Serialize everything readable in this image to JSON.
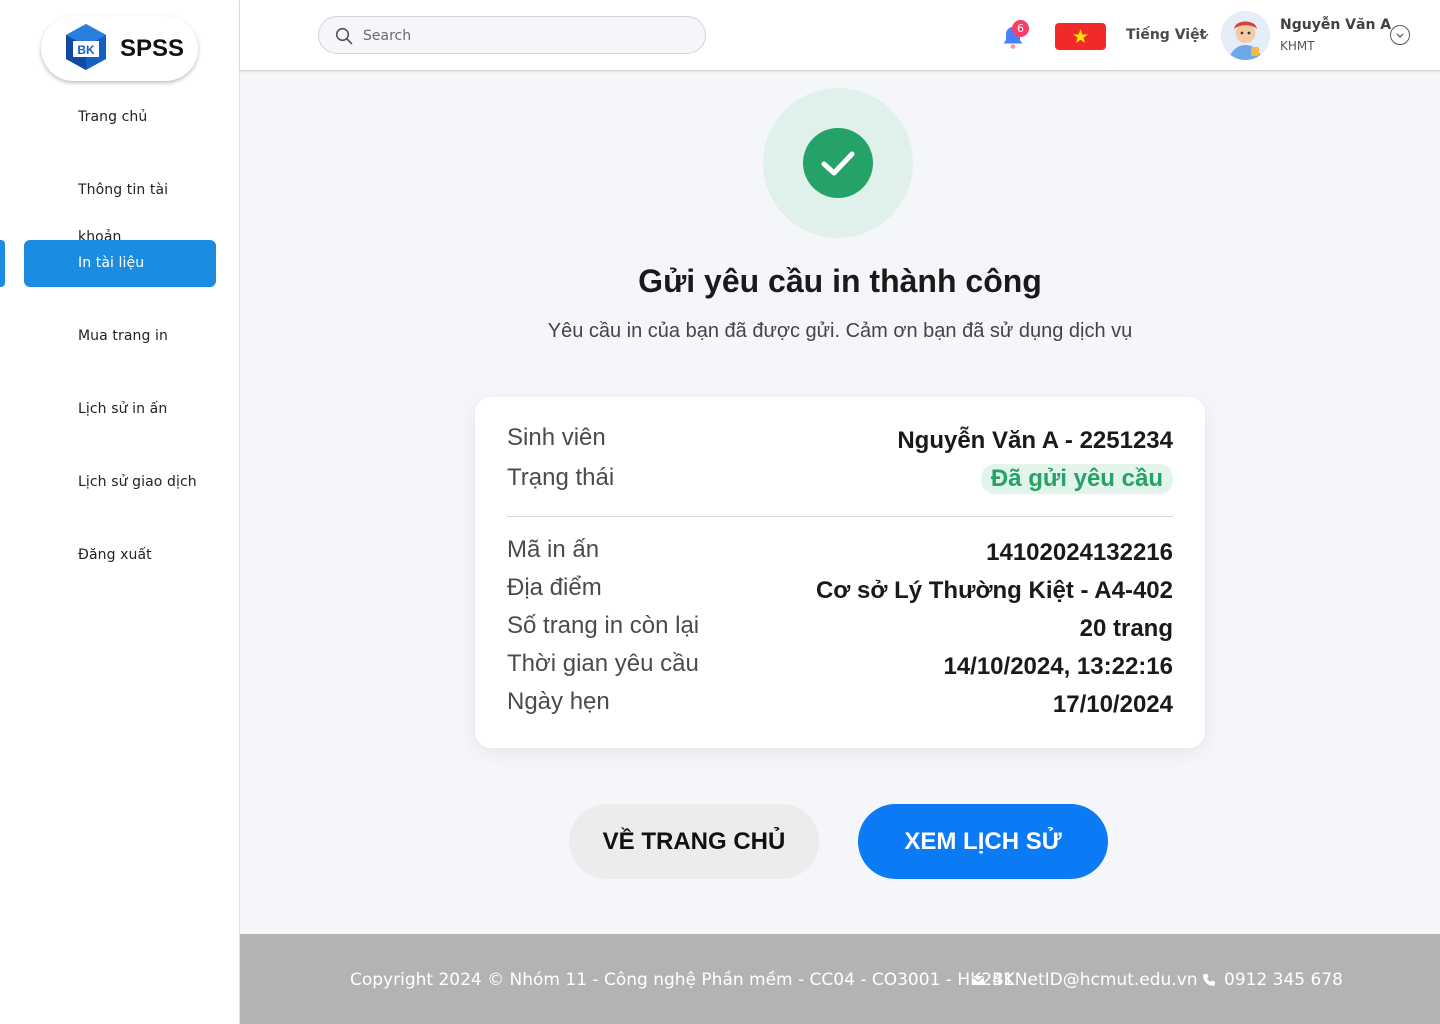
{
  "app": {
    "name": "SPSS",
    "logo_text": "BK"
  },
  "sidebar": {
    "items": [
      {
        "label": "Trang chủ",
        "active": false
      },
      {
        "label": "Thông tin tài khoản",
        "active": false
      },
      {
        "label": "In tài liệu",
        "active": true
      },
      {
        "label": "Mua trang in",
        "active": false
      },
      {
        "label": "Lịch sử in ấn",
        "active": false
      },
      {
        "label": "Lịch sử giao dịch",
        "active": false
      },
      {
        "label": "Đăng xuất",
        "active": false
      }
    ]
  },
  "header": {
    "search_placeholder": "Search",
    "notification_count": "6",
    "language": "Tiếng Việt",
    "user_name": "Nguyễn Văn A",
    "user_role": "KHMT"
  },
  "main": {
    "title": "Gửi yêu cầu in thành công",
    "subtitle": "Yêu cầu in của bạn đã được gửi. Cảm ơn bạn đã sử dụng dịch vụ",
    "card": {
      "student_label": "Sinh viên",
      "student_value": "Nguyễn Văn A - 2251234",
      "status_label": "Trạng thái",
      "status_value": "Đã gửi yêu cầu",
      "details": [
        {
          "label": "Mã in ấn",
          "value": "14102024132216"
        },
        {
          "label": "Địa điểm",
          "value": "Cơ sở Lý Thường Kiệt - A4-402"
        },
        {
          "label": "Số trang in còn lại",
          "value": "20 trang"
        },
        {
          "label": "Thời gian yêu cầu",
          "value": "14/10/2024, 13:22:16"
        },
        {
          "label": "Ngày hẹn",
          "value": "17/10/2024"
        }
      ]
    },
    "home_button": "VỀ TRANG CHỦ",
    "history_button": "XEM LỊCH SỬ"
  },
  "footer": {
    "copyright": "Copyright 2024 © Nhóm 11 - Công nghệ Phần mềm - CC04 - CO3001 - HK241",
    "email": "BKNetID@hcmut.edu.vn",
    "phone": "0912 345 678"
  },
  "colors": {
    "accent": "#1c8ce0",
    "primary_button": "#0a7af5",
    "success": "#25a267",
    "footer_bg": "#b3b3b3"
  }
}
